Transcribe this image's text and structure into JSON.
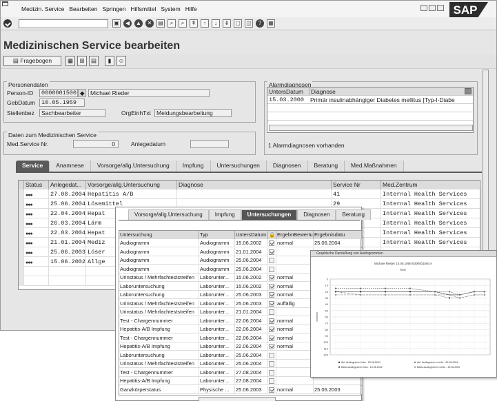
{
  "menu": [
    "Medizin. Service",
    "Bearbeiten",
    "Springen",
    "Hilfsmittel",
    "System",
    "Hilfe"
  ],
  "brand": "SAP",
  "title": "Medizinischen Service bearbeiten",
  "app_toolbar": {
    "fragebogen": "Fragebogen"
  },
  "personendaten": {
    "title": "Personendaten",
    "person_id_label": "Person-ID",
    "person_id": "0000001500",
    "person_name": "Michael Rieder",
    "gebdatum_label": "GebDatum",
    "gebdatum": "10.05.1959",
    "stellenbez_label": "Stellenbez",
    "stellenbez": "Sachbearbeiter",
    "orgeinh_label": "OrgEinhTxt",
    "orgeinh": "Meldungsbearbeitung"
  },
  "med_service": {
    "title": "Daten zum Medizinischen Service",
    "nr_label": "Med.Service Nr.",
    "nr": "0",
    "anlegedatum_label": "Anlegedatum"
  },
  "alarm": {
    "title": "Alarmdiagnosen",
    "col_datum": "UntersDatum",
    "col_diagnose": "Diagnose",
    "rows": [
      {
        "datum": "15.03.2000",
        "diagnose": "Primär insulinabhängiger Diabetes mellitus [Typ-I-Diabe"
      }
    ],
    "count_text": "1 Alarmdiagnosen vorhanden"
  },
  "tabs": [
    "Service",
    "Anamnese",
    "Vorsorge/allg.Untersuchung",
    "Impfung",
    "Untersuchungen",
    "Diagnosen",
    "Beratung",
    "Med.Maßnahmen"
  ],
  "service_table": {
    "headers": [
      "Status",
      "Anlegedat...",
      "Vorsorge/allg.Untersuchung",
      "Diagnose",
      "Service Nr",
      "Med.Zentrum"
    ],
    "rows": [
      {
        "datum": "27.08.2004",
        "vorsorge": "Hepatitis A/B",
        "service_nr": "41",
        "zentrum": "Internal Health Services"
      },
      {
        "datum": "25.06.2004",
        "vorsorge": "Lösemittel",
        "service_nr": "29",
        "zentrum": "Internal Health Services"
      },
      {
        "datum": "22.04.2004",
        "vorsorge": "Hepat",
        "service_nr": "",
        "zentrum": "Internal Health Services"
      },
      {
        "datum": "26.03.2004",
        "vorsorge": "Lärm",
        "service_nr": "",
        "zentrum": "Internal Health Services"
      },
      {
        "datum": "22.03.2004",
        "vorsorge": "Hepat",
        "service_nr": "",
        "zentrum": "Internal Health Services"
      },
      {
        "datum": "21.01.2004",
        "vorsorge": "Mediz",
        "service_nr": "",
        "zentrum": "Internal Health Services"
      },
      {
        "datum": "25.06.2003",
        "vorsorge": "Löser",
        "service_nr": "",
        "zentrum": ""
      },
      {
        "datum": "15.06.2002",
        "vorsorge": "Allge",
        "service_nr": "",
        "zentrum": ""
      }
    ]
  },
  "overlay": {
    "tabs": [
      "Vorsorge/allg.Untersuchung",
      "Impfung",
      "Untersuchungen",
      "Diagnosen",
      "Beratung"
    ],
    "headers": [
      "Untersuchung",
      "Typ",
      "UntersDatum",
      "",
      "ErgebnBewertung",
      "Ergebnisdatu"
    ],
    "rows": [
      {
        "u": "Audiogramm",
        "t": "Audiogramm",
        "d": "15.06.2002",
        "c": true,
        "e": "normal",
        "ed": "25.06.2004"
      },
      {
        "u": "Audiogramm",
        "t": "Audiogramm",
        "d": "21.01.2004",
        "c": true,
        "e": "",
        "ed": ""
      },
      {
        "u": "Audiogramm",
        "t": "Audiogramm",
        "d": "25.06.2004",
        "c": false,
        "e": "",
        "ed": ""
      },
      {
        "u": "Audiogramm",
        "t": "Audiogramm",
        "d": "25.06.2004",
        "c": false,
        "e": "",
        "ed": ""
      },
      {
        "u": "Urinstatus / Mehrfachteststreifen",
        "t": "Laborunter...",
        "d": "15.06.2002",
        "c": true,
        "e": "normal",
        "ed": ""
      },
      {
        "u": "Laboruntersuchung",
        "t": "Laborunter...",
        "d": "15.06.2002",
        "c": true,
        "e": "normal",
        "ed": ""
      },
      {
        "u": "Laboruntersuchung",
        "t": "Laborunter...",
        "d": "25.06.2003",
        "c": true,
        "e": "normal",
        "ed": ""
      },
      {
        "u": "Urinstatus / Mehrfachteststreifen",
        "t": "Laborunter...",
        "d": "25.06.2003",
        "c": true,
        "e": "auffällig",
        "ed": ""
      },
      {
        "u": "Urinstatus / Mehrfachteststreifen",
        "t": "Laborunter...",
        "d": "21.01.2004",
        "c": false,
        "e": "",
        "ed": ""
      },
      {
        "u": "Test - Chargennummer",
        "t": "Laborunter...",
        "d": "22.06.2004",
        "c": true,
        "e": "normal",
        "ed": ""
      },
      {
        "u": "Hepatitis-A/B Impfung",
        "t": "Laborunter...",
        "d": "22.06.2004",
        "c": true,
        "e": "normal",
        "ed": ""
      },
      {
        "u": "Test - Chargennummer",
        "t": "Laborunter...",
        "d": "22.06.2004",
        "c": true,
        "e": "normal",
        "ed": ""
      },
      {
        "u": "Hepatitis-A/B Impfung",
        "t": "Laborunter...",
        "d": "22.06.2004",
        "c": true,
        "e": "normal",
        "ed": ""
      },
      {
        "u": "Laboruntersuchung",
        "t": "Laborunter...",
        "d": "25.06.2004",
        "c": false,
        "e": "",
        "ed": ""
      },
      {
        "u": "Urinstatus / Mehrfachteststreifen",
        "t": "Laborunter...",
        "d": "25.06.2004",
        "c": false,
        "e": "",
        "ed": ""
      },
      {
        "u": "Test - Chargennummer",
        "t": "Laborunter...",
        "d": "27.08.2004",
        "c": false,
        "e": "",
        "ed": ""
      },
      {
        "u": "Hepatitis-A/B Impfung",
        "t": "Laborunter...",
        "d": "27.08.2004",
        "c": false,
        "e": "",
        "ed": ""
      },
      {
        "u": "Ganzkörperstatus",
        "t": "Physische ...",
        "d": "25.06.2003",
        "c": true,
        "e": "normal",
        "ed": "25.06.2003"
      }
    ]
  },
  "chart_window": {
    "title": "Graphische Darstellung von Audiogrammen",
    "chart_title": "Michael Rieder 10.05.1959 0000001500 A",
    "x_label": "kHz",
    "y_label": "Dezibel",
    "y_ticks": [
      "0",
      "10",
      "20",
      "30",
      "40",
      "50",
      "60",
      "70",
      "80",
      "90",
      "100",
      "110",
      "120"
    ],
    "legend": [
      "Akt. Audiogramm links - 25.06.2004",
      "Akt. Audiogramm rechts - 25.06.2004",
      "Basis-Audiogramm links - 15.06.2002",
      "Basis-Audiogramm rechts - 15.06.2002"
    ]
  },
  "chart_data": {
    "type": "line",
    "title": "Michael Rieder 10.05.1959 0000001500 A",
    "xlabel": "kHz",
    "ylabel": "Dezibel",
    "ylim": [
      0,
      120
    ],
    "x": [
      0.125,
      0.25,
      0.5,
      1,
      2,
      3,
      4,
      6,
      8
    ],
    "series": [
      {
        "name": "Akt. Audiogramm links - 25.06.2004",
        "values": [
          20,
          20,
          20,
          20,
          20,
          25,
          25,
          20,
          20
        ]
      },
      {
        "name": "Akt. Audiogramm rechts - 25.06.2004",
        "values": [
          15,
          15,
          15,
          15,
          20,
          20,
          25,
          20,
          20
        ]
      },
      {
        "name": "Basis-Audiogramm links - 15.06.2002",
        "values": [
          20,
          25,
          25,
          25,
          25,
          30,
          30,
          25,
          25
        ]
      },
      {
        "name": "Basis-Audiogramm rechts - 15.06.2002",
        "values": [
          25,
          25,
          25,
          25,
          25,
          25,
          30,
          25,
          25
        ]
      }
    ]
  }
}
